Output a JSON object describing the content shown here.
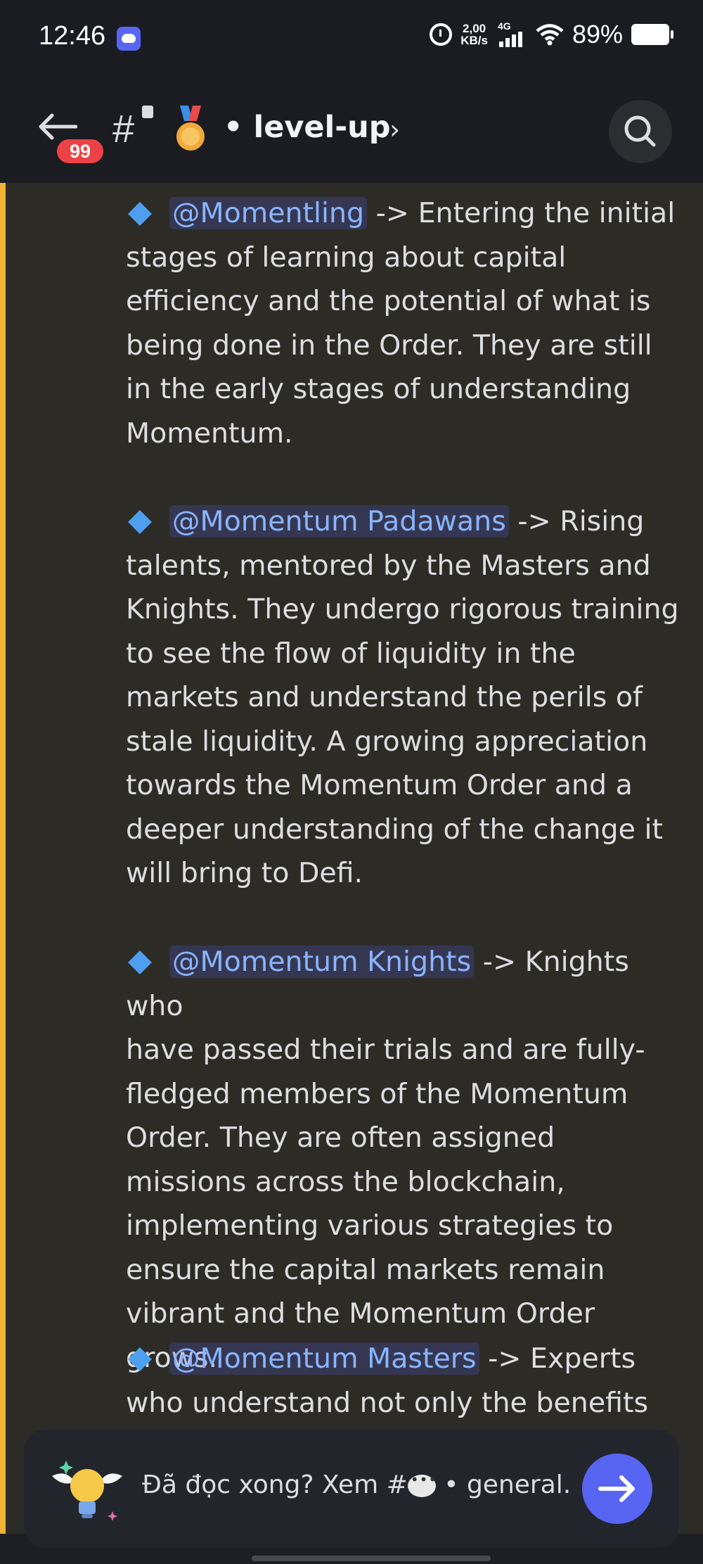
{
  "status_bar": {
    "time": "12:46",
    "net_speed_value": "2,00",
    "net_speed_unit": "KB/s",
    "network_type": "4G",
    "battery_percent": "89%"
  },
  "header": {
    "unread_badge": "99",
    "channel_name": "• level-up",
    "channel_emoji": "medal"
  },
  "messages": [
    {
      "mention": "@Momentling",
      "text_first": " -> Entering the initial",
      "text_rest": "stages of learning about capital efficiency and the potential of what is being done in the Order. They are still in the early stages of understanding Momentum."
    },
    {
      "mention": "@Momentum Padawans",
      "text_first": "  -> Rising",
      "text_rest": "talents, mentored by the Masters and Knights. They undergo rigorous training to see the flow of liquidity in the markets and understand the perils of stale liquidity. A growing appreciation towards the Momentum Order and a deeper understanding of the change it will bring to Defi."
    },
    {
      "mention": "@Momentum Knights",
      "text_first": " -> Knights who",
      "text_rest": "have passed their trials and are fully-fledged members of the Momentum Order. They are often assigned missions across the blockchain, implementing various strategies to ensure the capital markets remain vibrant and the Momentum Order grows."
    },
    {
      "mention": "@Momentum Masters",
      "text_first": "  -> Experts",
      "text_rest": "who understand not only the benefits of"
    }
  ],
  "read_bar": {
    "text_before": "Đã đọc xong? Xem #",
    "text_after": " • general."
  },
  "colors": {
    "accent": "#5865f2",
    "rail": "#f0b232",
    "badge": "#ed4245",
    "mention": "#8ab4ff"
  }
}
